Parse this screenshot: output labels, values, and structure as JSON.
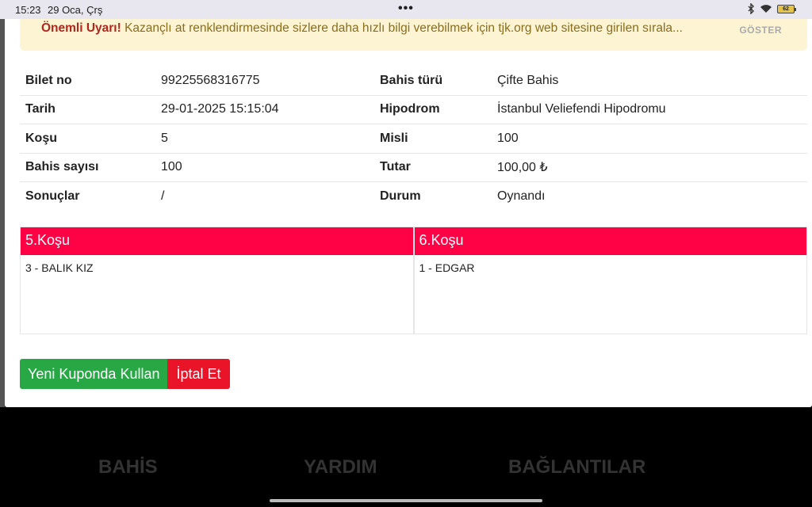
{
  "status_bar": {
    "time": "15:23",
    "date": "29 Oca, Çrş",
    "dots": "•••",
    "battery": "62"
  },
  "warning": {
    "title": "Önemli Uyarı!",
    "message": "Kazançlı at renklendirmesinde sizlere daha hızlı bilgi verebilmek için tjk.org web sitesine girilen sırala...",
    "action_label": "GÖSTER"
  },
  "ticket": {
    "rows": [
      {
        "label1": "Bilet no",
        "value1": "99225568316775",
        "label2": "Bahis türü",
        "value2": "Çifte Bahis"
      },
      {
        "label1": "Tarih",
        "value1": "29-01-2025 15:15:04",
        "label2": "Hipodrom",
        "value2": "İstanbul Veliefendi Hipodromu"
      },
      {
        "label1": "Koşu",
        "value1": "5",
        "label2": "Misli",
        "value2": "100"
      },
      {
        "label1": "Bahis sayısı",
        "value1": "100",
        "label2": "Tutar",
        "value2": "100,00 ₺"
      },
      {
        "label1": "Sonuçlar",
        "value1": "/",
        "label2": "Durum",
        "value2": "Oynandı"
      }
    ]
  },
  "races": [
    {
      "title": "5.Koşu",
      "selection": "3 - BALIK KIZ"
    },
    {
      "title": "6.Koşu",
      "selection": "1 - EDGAR"
    }
  ],
  "actions": {
    "reuse_label": "Yeni Kuponda Kullan",
    "cancel_label": "İptal Et"
  },
  "footer": {
    "items": [
      "BAHİS",
      "YARDIM",
      "BAĞLANTILAR"
    ]
  },
  "colors": {
    "race_header": "#ff0145",
    "reuse_button": "#28a745",
    "cancel_button": "#ea1429",
    "warning_bg": "#fcf4d3"
  }
}
